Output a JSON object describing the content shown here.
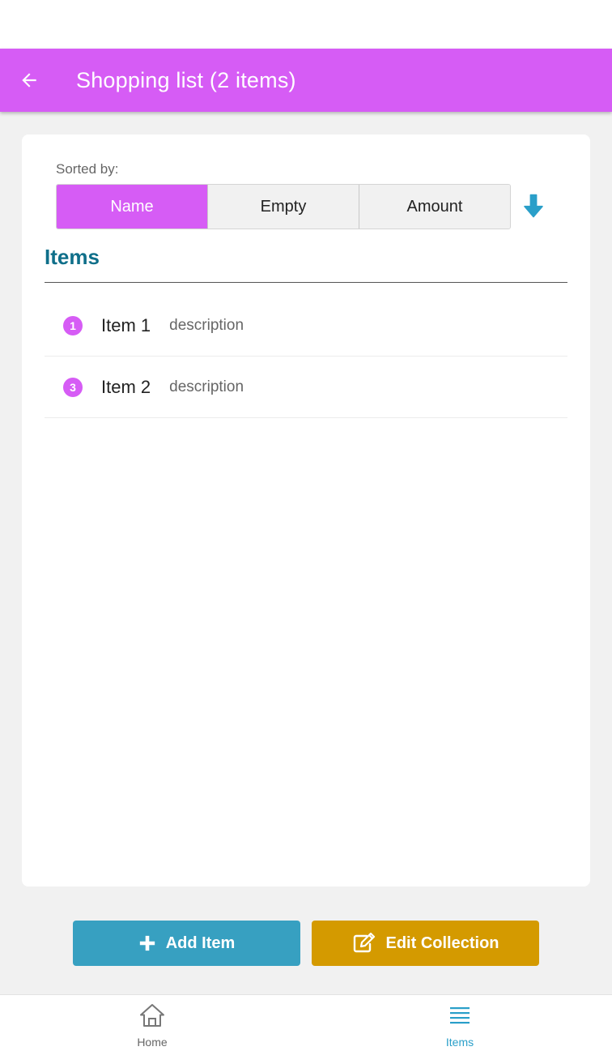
{
  "header": {
    "title": "Shopping list (2 items)"
  },
  "sort": {
    "label": "Sorted by:",
    "options": [
      "Name",
      "Empty",
      "Amount"
    ],
    "selected": "Name",
    "direction_icon": "arrow-down-icon"
  },
  "list": {
    "title": "Items",
    "items": [
      {
        "badge": "1",
        "name": "Item 1",
        "description": "description"
      },
      {
        "badge": "3",
        "name": "Item 2",
        "description": "description"
      }
    ]
  },
  "actions": {
    "add_label": "Add Item",
    "edit_label": "Edit Collection"
  },
  "nav": {
    "home_label": "Home",
    "items_label": "Items",
    "active": "Items"
  },
  "colors": {
    "primary": "#d65cf5",
    "accent": "#37a0c1",
    "edit": "#d49a00",
    "title": "#0f6f8a"
  }
}
